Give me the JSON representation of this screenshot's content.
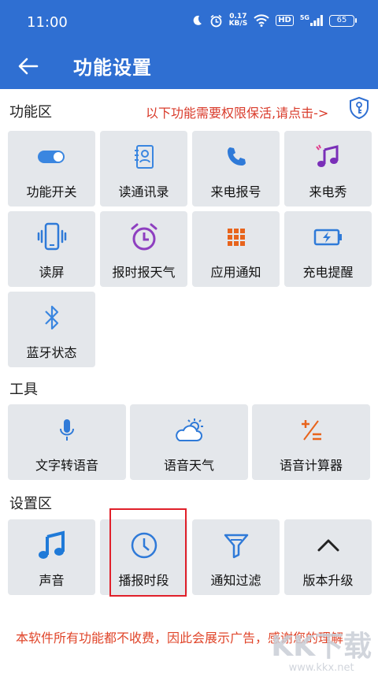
{
  "status_bar": {
    "time": "11:00",
    "net_speed_value": "0.17",
    "net_speed_unit": "KB/S",
    "hd_label": "HD",
    "signal_label": "5G",
    "battery_level": "65"
  },
  "app_bar": {
    "back_icon": "arrow-left-icon",
    "title": "功能设置"
  },
  "function_section": {
    "title": "功能区",
    "notice": "以下功能需要权限保活,请点击->",
    "items": [
      {
        "label": "功能开关",
        "icon": "toggle-icon"
      },
      {
        "label": "读通讯录",
        "icon": "contacts-icon"
      },
      {
        "label": "来电报号",
        "icon": "phone-icon"
      },
      {
        "label": "来电秀",
        "icon": "music-note-icon"
      },
      {
        "label": "读屏",
        "icon": "phone-vibrate-icon"
      },
      {
        "label": "报时报天气",
        "icon": "alarm-clock-icon"
      },
      {
        "label": "应用通知",
        "icon": "apps-grid-icon"
      },
      {
        "label": "充电提醒",
        "icon": "battery-charging-icon"
      },
      {
        "label": "蓝牙状态",
        "icon": "bluetooth-icon"
      }
    ]
  },
  "tools_section": {
    "title": "工具",
    "items": [
      {
        "label": "文字转语音",
        "icon": "microphone-icon"
      },
      {
        "label": "语音天气",
        "icon": "weather-icon"
      },
      {
        "label": "语音计算器",
        "icon": "calculator-icon"
      }
    ]
  },
  "settings_section": {
    "title": "设置区",
    "items": [
      {
        "label": "声音",
        "icon": "music-icon"
      },
      {
        "label": "播报时段",
        "icon": "clock-icon"
      },
      {
        "label": "通知过滤",
        "icon": "filter-icon"
      },
      {
        "label": "版本升级",
        "icon": "chevron-up-icon"
      }
    ]
  },
  "footer": {
    "text": "本软件所有功能都不收费，因此会展示广告，感谢您的理解"
  },
  "watermark": {
    "big": "KK下载",
    "small": "www.kkx.net"
  },
  "colors": {
    "primary": "#2f6fd2",
    "tile_bg": "#e4e7eb",
    "notice": "#d93b2b",
    "highlight": "#e0202a"
  }
}
